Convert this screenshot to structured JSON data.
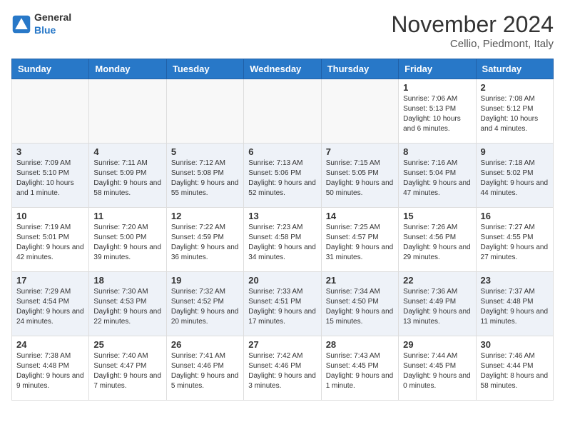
{
  "header": {
    "logo_general": "General",
    "logo_blue": "Blue",
    "month_title": "November 2024",
    "location": "Cellio, Piedmont, Italy"
  },
  "weekdays": [
    "Sunday",
    "Monday",
    "Tuesday",
    "Wednesday",
    "Thursday",
    "Friday",
    "Saturday"
  ],
  "weeks": [
    [
      {
        "day": "",
        "empty": true
      },
      {
        "day": "",
        "empty": true
      },
      {
        "day": "",
        "empty": true
      },
      {
        "day": "",
        "empty": true
      },
      {
        "day": "",
        "empty": true
      },
      {
        "day": "1",
        "sunrise": "Sunrise: 7:06 AM",
        "sunset": "Sunset: 5:13 PM",
        "daylight": "Daylight: 10 hours and 6 minutes."
      },
      {
        "day": "2",
        "sunrise": "Sunrise: 7:08 AM",
        "sunset": "Sunset: 5:12 PM",
        "daylight": "Daylight: 10 hours and 4 minutes."
      }
    ],
    [
      {
        "day": "3",
        "sunrise": "Sunrise: 7:09 AM",
        "sunset": "Sunset: 5:10 PM",
        "daylight": "Daylight: 10 hours and 1 minute."
      },
      {
        "day": "4",
        "sunrise": "Sunrise: 7:11 AM",
        "sunset": "Sunset: 5:09 PM",
        "daylight": "Daylight: 9 hours and 58 minutes."
      },
      {
        "day": "5",
        "sunrise": "Sunrise: 7:12 AM",
        "sunset": "Sunset: 5:08 PM",
        "daylight": "Daylight: 9 hours and 55 minutes."
      },
      {
        "day": "6",
        "sunrise": "Sunrise: 7:13 AM",
        "sunset": "Sunset: 5:06 PM",
        "daylight": "Daylight: 9 hours and 52 minutes."
      },
      {
        "day": "7",
        "sunrise": "Sunrise: 7:15 AM",
        "sunset": "Sunset: 5:05 PM",
        "daylight": "Daylight: 9 hours and 50 minutes."
      },
      {
        "day": "8",
        "sunrise": "Sunrise: 7:16 AM",
        "sunset": "Sunset: 5:04 PM",
        "daylight": "Daylight: 9 hours and 47 minutes."
      },
      {
        "day": "9",
        "sunrise": "Sunrise: 7:18 AM",
        "sunset": "Sunset: 5:02 PM",
        "daylight": "Daylight: 9 hours and 44 minutes."
      }
    ],
    [
      {
        "day": "10",
        "sunrise": "Sunrise: 7:19 AM",
        "sunset": "Sunset: 5:01 PM",
        "daylight": "Daylight: 9 hours and 42 minutes."
      },
      {
        "day": "11",
        "sunrise": "Sunrise: 7:20 AM",
        "sunset": "Sunset: 5:00 PM",
        "daylight": "Daylight: 9 hours and 39 minutes."
      },
      {
        "day": "12",
        "sunrise": "Sunrise: 7:22 AM",
        "sunset": "Sunset: 4:59 PM",
        "daylight": "Daylight: 9 hours and 36 minutes."
      },
      {
        "day": "13",
        "sunrise": "Sunrise: 7:23 AM",
        "sunset": "Sunset: 4:58 PM",
        "daylight": "Daylight: 9 hours and 34 minutes."
      },
      {
        "day": "14",
        "sunrise": "Sunrise: 7:25 AM",
        "sunset": "Sunset: 4:57 PM",
        "daylight": "Daylight: 9 hours and 31 minutes."
      },
      {
        "day": "15",
        "sunrise": "Sunrise: 7:26 AM",
        "sunset": "Sunset: 4:56 PM",
        "daylight": "Daylight: 9 hours and 29 minutes."
      },
      {
        "day": "16",
        "sunrise": "Sunrise: 7:27 AM",
        "sunset": "Sunset: 4:55 PM",
        "daylight": "Daylight: 9 hours and 27 minutes."
      }
    ],
    [
      {
        "day": "17",
        "sunrise": "Sunrise: 7:29 AM",
        "sunset": "Sunset: 4:54 PM",
        "daylight": "Daylight: 9 hours and 24 minutes."
      },
      {
        "day": "18",
        "sunrise": "Sunrise: 7:30 AM",
        "sunset": "Sunset: 4:53 PM",
        "daylight": "Daylight: 9 hours and 22 minutes."
      },
      {
        "day": "19",
        "sunrise": "Sunrise: 7:32 AM",
        "sunset": "Sunset: 4:52 PM",
        "daylight": "Daylight: 9 hours and 20 minutes."
      },
      {
        "day": "20",
        "sunrise": "Sunrise: 7:33 AM",
        "sunset": "Sunset: 4:51 PM",
        "daylight": "Daylight: 9 hours and 17 minutes."
      },
      {
        "day": "21",
        "sunrise": "Sunrise: 7:34 AM",
        "sunset": "Sunset: 4:50 PM",
        "daylight": "Daylight: 9 hours and 15 minutes."
      },
      {
        "day": "22",
        "sunrise": "Sunrise: 7:36 AM",
        "sunset": "Sunset: 4:49 PM",
        "daylight": "Daylight: 9 hours and 13 minutes."
      },
      {
        "day": "23",
        "sunrise": "Sunrise: 7:37 AM",
        "sunset": "Sunset: 4:48 PM",
        "daylight": "Daylight: 9 hours and 11 minutes."
      }
    ],
    [
      {
        "day": "24",
        "sunrise": "Sunrise: 7:38 AM",
        "sunset": "Sunset: 4:48 PM",
        "daylight": "Daylight: 9 hours and 9 minutes."
      },
      {
        "day": "25",
        "sunrise": "Sunrise: 7:40 AM",
        "sunset": "Sunset: 4:47 PM",
        "daylight": "Daylight: 9 hours and 7 minutes."
      },
      {
        "day": "26",
        "sunrise": "Sunrise: 7:41 AM",
        "sunset": "Sunset: 4:46 PM",
        "daylight": "Daylight: 9 hours and 5 minutes."
      },
      {
        "day": "27",
        "sunrise": "Sunrise: 7:42 AM",
        "sunset": "Sunset: 4:46 PM",
        "daylight": "Daylight: 9 hours and 3 minutes."
      },
      {
        "day": "28",
        "sunrise": "Sunrise: 7:43 AM",
        "sunset": "Sunset: 4:45 PM",
        "daylight": "Daylight: 9 hours and 1 minute."
      },
      {
        "day": "29",
        "sunrise": "Sunrise: 7:44 AM",
        "sunset": "Sunset: 4:45 PM",
        "daylight": "Daylight: 9 hours and 0 minutes."
      },
      {
        "day": "30",
        "sunrise": "Sunrise: 7:46 AM",
        "sunset": "Sunset: 4:44 PM",
        "daylight": "Daylight: 8 hours and 58 minutes."
      }
    ]
  ]
}
